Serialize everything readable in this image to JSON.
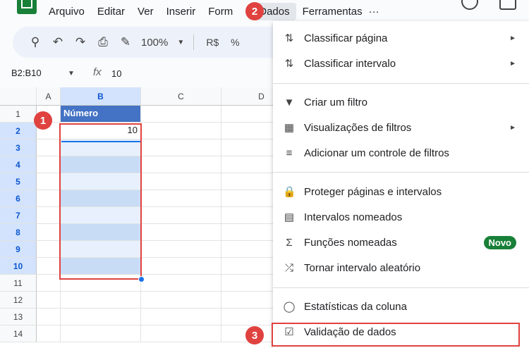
{
  "menubar": {
    "items": [
      "Arquivo",
      "Editar",
      "Ver",
      "Inserir",
      "Formatar",
      "Dados",
      "Ferramentas",
      "..."
    ],
    "visible_labels": [
      "Arquivo",
      "Editar",
      "Ver",
      "Inserir",
      "Form",
      "Dados",
      "Ferramentas",
      "···"
    ]
  },
  "toolbar": {
    "zoom": "100%",
    "currency": "R$",
    "percent": "%"
  },
  "formula": {
    "namebox": "B2:B10",
    "fx": "fx",
    "value": "10"
  },
  "grid": {
    "columns": [
      "A",
      "B",
      "C",
      "D"
    ],
    "rows": [
      "1",
      "2",
      "3",
      "4",
      "5",
      "6",
      "7",
      "8",
      "9",
      "10",
      "11",
      "12",
      "13",
      "14"
    ],
    "b1": "Número",
    "b2": "10"
  },
  "badges": [
    "1",
    "2",
    "3"
  ],
  "menu": {
    "items": [
      {
        "label": "Classificar página",
        "icon": "sort-icon",
        "submenu": true
      },
      {
        "label": "Classificar intervalo",
        "icon": "sort-icon",
        "submenu": true
      },
      {
        "label": "Criar um filtro",
        "icon": "filter-icon",
        "submenu": false
      },
      {
        "label": "Visualizações de filtros",
        "icon": "filter-views-icon",
        "submenu": true
      },
      {
        "label": "Adicionar um controle de filtros",
        "icon": "filter-list-icon",
        "submenu": false
      },
      {
        "label": "Proteger páginas e intervalos",
        "icon": "lock-icon",
        "submenu": false
      },
      {
        "label": "Intervalos nomeados",
        "icon": "named-range-icon",
        "submenu": false
      },
      {
        "label": "Funções nomeadas",
        "icon": "sigma-icon",
        "submenu": false,
        "badge": "Novo"
      },
      {
        "label": "Tornar intervalo aleatório",
        "icon": "shuffle-icon",
        "submenu": false
      },
      {
        "label": "Estatísticas da coluna",
        "icon": "lightbulb-icon",
        "submenu": false
      },
      {
        "label": "Validação de dados",
        "icon": "data-validation-icon",
        "submenu": false
      }
    ]
  },
  "colors": {
    "header_fill": "#4472c4",
    "highlight": "#e0423f",
    "selection": "#d3e3fd",
    "novo_badge": "#188038"
  }
}
